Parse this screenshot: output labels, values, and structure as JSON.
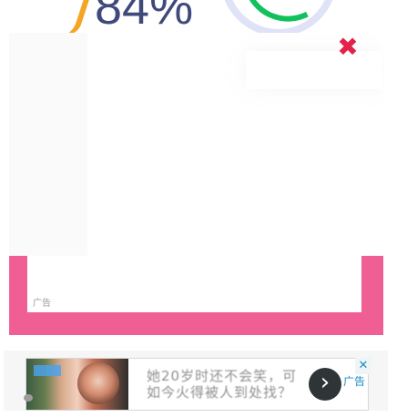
{
  "status_widget": {
    "percent": "84%",
    "accent_orange": "#f5a524",
    "accent_green": "#11c15b"
  },
  "popup_ad": {
    "close_icon": "close-icon",
    "ad_label": "广告",
    "frame_color": "#ef5f93"
  },
  "banner_ad": {
    "headline_line_1": "她20岁时还不会笑，可",
    "headline_line_2": "如今火得被人到处找？",
    "ad_label": "广告",
    "close_icon": "close-icon",
    "next_icon": "chevron-right-icon"
  }
}
